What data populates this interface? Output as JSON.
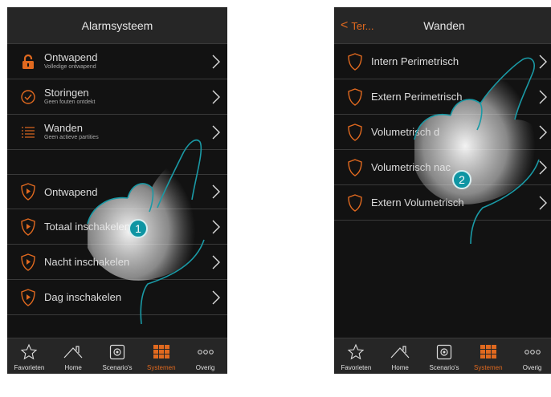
{
  "left_screen": {
    "title": "Alarmsysteem",
    "rows": [
      {
        "label": "Ontwapend",
        "sub": "Volledige ontwapend",
        "icon": "padlock-open-icon"
      },
      {
        "label": "Storingen",
        "sub": "Geen fouten ontdekt",
        "icon": "check-circle-icon"
      },
      {
        "label": "Wanden",
        "sub": "Geen actieve partities",
        "icon": "list-icon"
      },
      {
        "label": "Ontwapend",
        "icon": "shield-play-icon"
      },
      {
        "label": "Totaal inschakelen",
        "icon": "shield-play-icon"
      },
      {
        "label": "Nacht inschakelen",
        "icon": "shield-play-icon"
      },
      {
        "label": "Dag inschakelen",
        "icon": "shield-play-icon"
      }
    ],
    "step": "1"
  },
  "right_screen": {
    "title": "Wanden",
    "back_label": "Ter...",
    "rows": [
      {
        "label": "Intern Perimetrisch",
        "icon": "shield-icon"
      },
      {
        "label": "Extern Perimetrisch",
        "icon": "shield-icon"
      },
      {
        "label": "Volumetrisch d",
        "icon": "shield-icon"
      },
      {
        "label": "Volumetrisch nac",
        "icon": "shield-icon"
      },
      {
        "label": "Extern Volumetrisch",
        "icon": "shield-icon"
      }
    ],
    "step": "2"
  },
  "tabbar": [
    {
      "label": "Favorieten",
      "icon": "star-icon"
    },
    {
      "label": "Home",
      "icon": "house-icon"
    },
    {
      "label": "Scenario's",
      "icon": "scenario-icon"
    },
    {
      "label": "Systemen",
      "icon": "grid-icon",
      "active": true
    },
    {
      "label": "Overig",
      "icon": "more-icon"
    }
  ],
  "colors": {
    "accent": "#e0691f",
    "badge": "#0e95a3",
    "background": "#121212"
  }
}
